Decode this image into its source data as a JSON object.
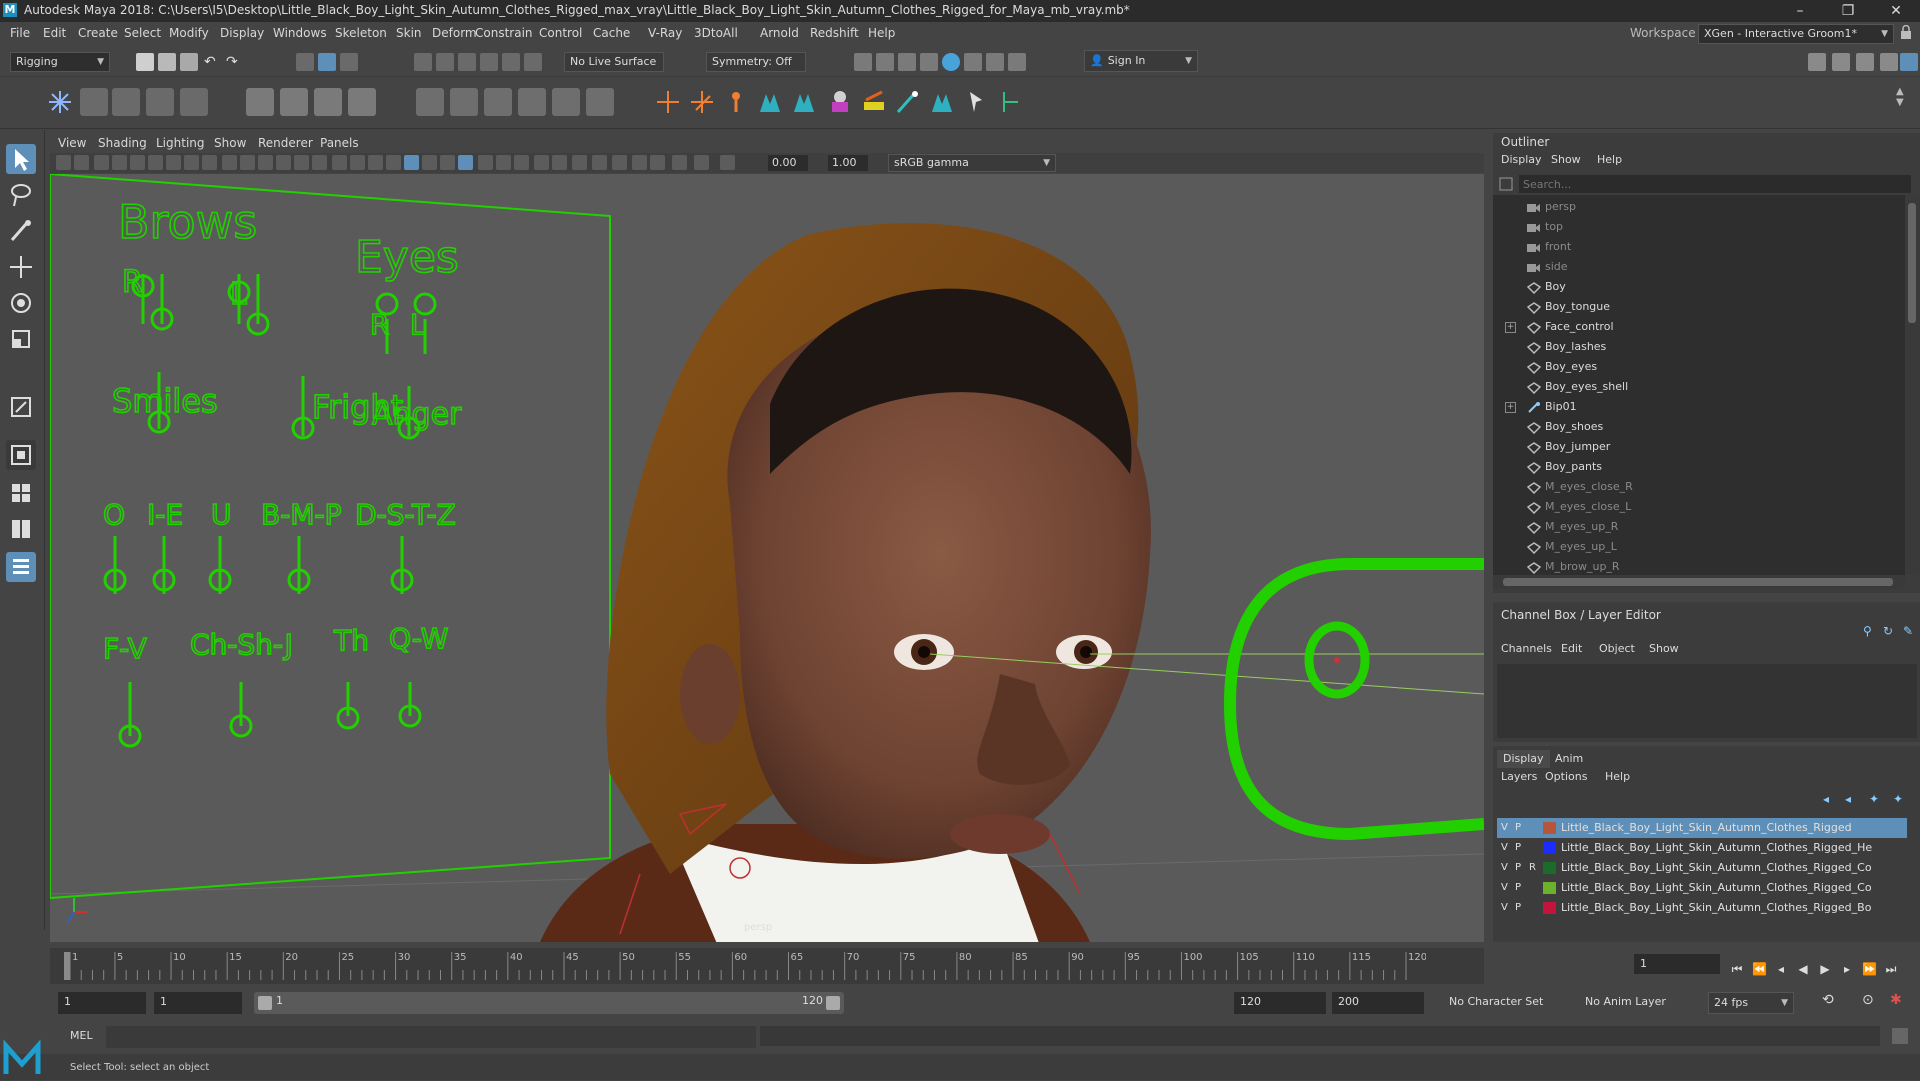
{
  "app": {
    "logo_letter": "M",
    "title": "Autodesk Maya 2018: C:\\Users\\I5\\Desktop\\Little_Black_Boy_Light_Skin_Autumn_Clothes_Rigged_max_vray\\Little_Black_Boy_Light_Skin_Autumn_Clothes_Rigged_for_Maya_mb_vray.mb*",
    "minimize": "–",
    "maximize": "❐",
    "close": "✕"
  },
  "menubar": {
    "items": [
      "File",
      "Edit",
      "Create",
      "Select",
      "Modify",
      "Display",
      "Windows",
      "Skeleton",
      "Skin",
      "Deform",
      "Constrain",
      "Control",
      "Cache",
      "V-Ray",
      "3DtoAll",
      "Arnold",
      "Redshift",
      "Help"
    ],
    "workspace_label": "Workspace :",
    "workspace_value": "XGen - Interactive Groom1*"
  },
  "statusline": {
    "mode": "Rigging",
    "live_surface": "No Live Surface",
    "symmetry": "Symmetry: Off",
    "sign_in": "Sign In"
  },
  "viewport_menu": [
    "View",
    "Shading",
    "Lighting",
    "Show",
    "Renderer",
    "Panels"
  ],
  "viewport_tools": {
    "exposure": "0.00",
    "gamma": "1.00",
    "colorspace": "sRGB gamma"
  },
  "viewport": {
    "camera_label": "persp",
    "face_board": {
      "labels": [
        {
          "text": "Brows"
        },
        {
          "text": "Eyes"
        },
        {
          "text": "R"
        },
        {
          "text": "L"
        },
        {
          "text": "R"
        },
        {
          "text": "L"
        },
        {
          "text": "Smiles"
        },
        {
          "text": "Fright"
        },
        {
          "text": "Anger"
        },
        {
          "text": "O"
        },
        {
          "text": "I-E"
        },
        {
          "text": "U"
        },
        {
          "text": "B-M-P"
        },
        {
          "text": "D-S-T-Z"
        },
        {
          "text": "F-V"
        },
        {
          "text": "Ch-Sh-J"
        },
        {
          "text": "Th"
        },
        {
          "text": "Q-W"
        }
      ],
      "color": "#22d000"
    }
  },
  "outliner": {
    "title": "Outliner",
    "menu": [
      "Display",
      "Show",
      "Help"
    ],
    "search_placeholder": "Search...",
    "items": [
      {
        "name": "persp",
        "dim": true,
        "type": "camera",
        "expand": false
      },
      {
        "name": "top",
        "dim": true,
        "type": "camera",
        "expand": false
      },
      {
        "name": "front",
        "dim": true,
        "type": "camera",
        "expand": false
      },
      {
        "name": "side",
        "dim": true,
        "type": "camera",
        "expand": false
      },
      {
        "name": "Boy",
        "dim": false,
        "type": "mesh",
        "expand": false
      },
      {
        "name": "Boy_tongue",
        "dim": false,
        "type": "mesh",
        "expand": false
      },
      {
        "name": "Face_control",
        "dim": false,
        "type": "mesh",
        "expand": true
      },
      {
        "name": "Boy_lashes",
        "dim": false,
        "type": "mesh",
        "expand": false
      },
      {
        "name": "Boy_eyes",
        "dim": false,
        "type": "mesh",
        "expand": false
      },
      {
        "name": "Boy_eyes_shell",
        "dim": false,
        "type": "mesh",
        "expand": false
      },
      {
        "name": "Bip01",
        "dim": false,
        "type": "joint",
        "expand": true
      },
      {
        "name": "Boy_shoes",
        "dim": false,
        "type": "mesh",
        "expand": false
      },
      {
        "name": "Boy_jumper",
        "dim": false,
        "type": "mesh",
        "expand": false
      },
      {
        "name": "Boy_pants",
        "dim": false,
        "type": "mesh",
        "expand": false
      },
      {
        "name": "M_eyes_close_R",
        "dim": true,
        "type": "mesh",
        "expand": false
      },
      {
        "name": "M_eyes_close_L",
        "dim": true,
        "type": "mesh",
        "expand": false
      },
      {
        "name": "M_eyes_up_R",
        "dim": true,
        "type": "mesh",
        "expand": false
      },
      {
        "name": "M_eyes_up_L",
        "dim": true,
        "type": "mesh",
        "expand": false
      },
      {
        "name": "M_brow_up_R",
        "dim": true,
        "type": "mesh",
        "expand": false
      }
    ]
  },
  "channelbox": {
    "title": "Channel Box / Layer Editor",
    "menu": [
      "Channels",
      "Edit",
      "Object",
      "Show"
    ]
  },
  "layereditor": {
    "tabs": [
      "Display",
      "Anim"
    ],
    "menu": [
      "Layers",
      "Options",
      "Help"
    ],
    "layers": [
      {
        "v": "V",
        "p": "P",
        "r": "",
        "color": "#b5553a",
        "name": "Little_Black_Boy_Light_Skin_Autumn_Clothes_Rigged",
        "selected": true
      },
      {
        "v": "V",
        "p": "P",
        "r": "",
        "color": "#1a2cff",
        "name": "Little_Black_Boy_Light_Skin_Autumn_Clothes_Rigged_He",
        "selected": false
      },
      {
        "v": "V",
        "p": "P",
        "r": "R",
        "color": "#1b6b2a",
        "name": "Little_Black_Boy_Light_Skin_Autumn_Clothes_Rigged_Co",
        "selected": false
      },
      {
        "v": "V",
        "p": "P",
        "r": "",
        "color": "#6bb22a",
        "name": "Little_Black_Boy_Light_Skin_Autumn_Clothes_Rigged_Co",
        "selected": false
      },
      {
        "v": "V",
        "p": "P",
        "r": "",
        "color": "#c2143c",
        "name": "Little_Black_Boy_Light_Skin_Autumn_Clothes_Rigged_Bo",
        "selected": false
      }
    ]
  },
  "timeline": {
    "ticks": [
      "1",
      "5",
      "10",
      "15",
      "20",
      "25",
      "30",
      "35",
      "40",
      "45",
      "50",
      "55",
      "60",
      "65",
      "70",
      "75",
      "80",
      "85",
      "90",
      "95",
      "100",
      "105",
      "110",
      "115",
      "120"
    ],
    "current_frame": "1"
  },
  "range": {
    "start": "1",
    "playback_start": "1",
    "slider_start": "1",
    "slider_end": "120",
    "playback_end": "120",
    "end": "200",
    "character_set": "No Character Set",
    "anim_layer": "No Anim Layer",
    "fps": "24 fps"
  },
  "cmdline": {
    "label": "MEL"
  },
  "helpline": {
    "text": "Select Tool: select an object"
  }
}
